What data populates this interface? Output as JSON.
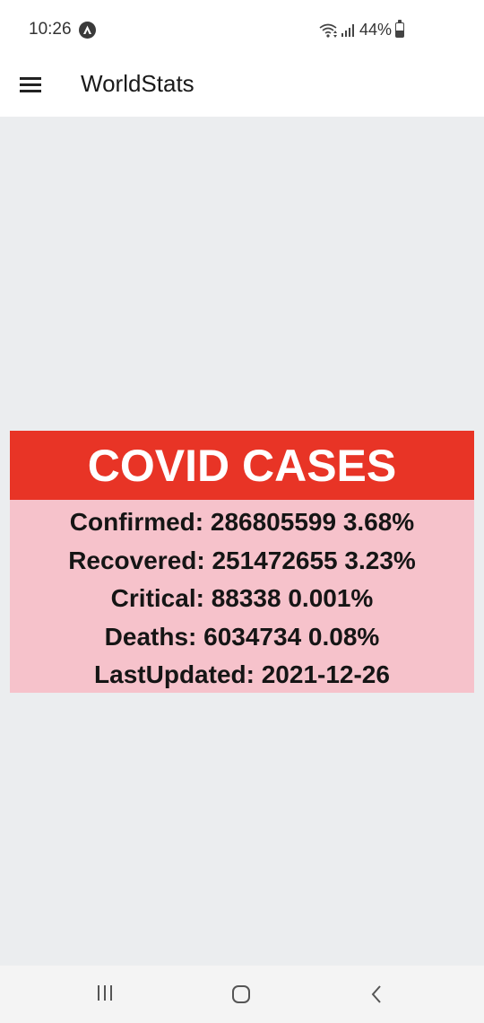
{
  "status_bar": {
    "time": "10:26",
    "battery": "44%",
    "battery_level": 0.44,
    "icons": [
      "app-notification-icon",
      "wifi-icon",
      "signal-icon",
      "battery-icon"
    ]
  },
  "app_bar": {
    "title": "WorldStats",
    "menu_icon": "menu-icon"
  },
  "card": {
    "title": "COVID CASES",
    "lines": [
      "Confirmed: 286805599 3.68%",
      "Recovered: 251472655 3.23%",
      "Critical: 88338 0.001%",
      "Deaths: 6034734 0.08%",
      "LastUpdated: 2021-12-26"
    ]
  },
  "nav_bar": {
    "icons": [
      "recent-apps-icon",
      "home-icon",
      "back-icon"
    ]
  },
  "colors": {
    "header_red": "#e83426",
    "body_pink": "#f6c2cb",
    "background": "#ebedef"
  }
}
